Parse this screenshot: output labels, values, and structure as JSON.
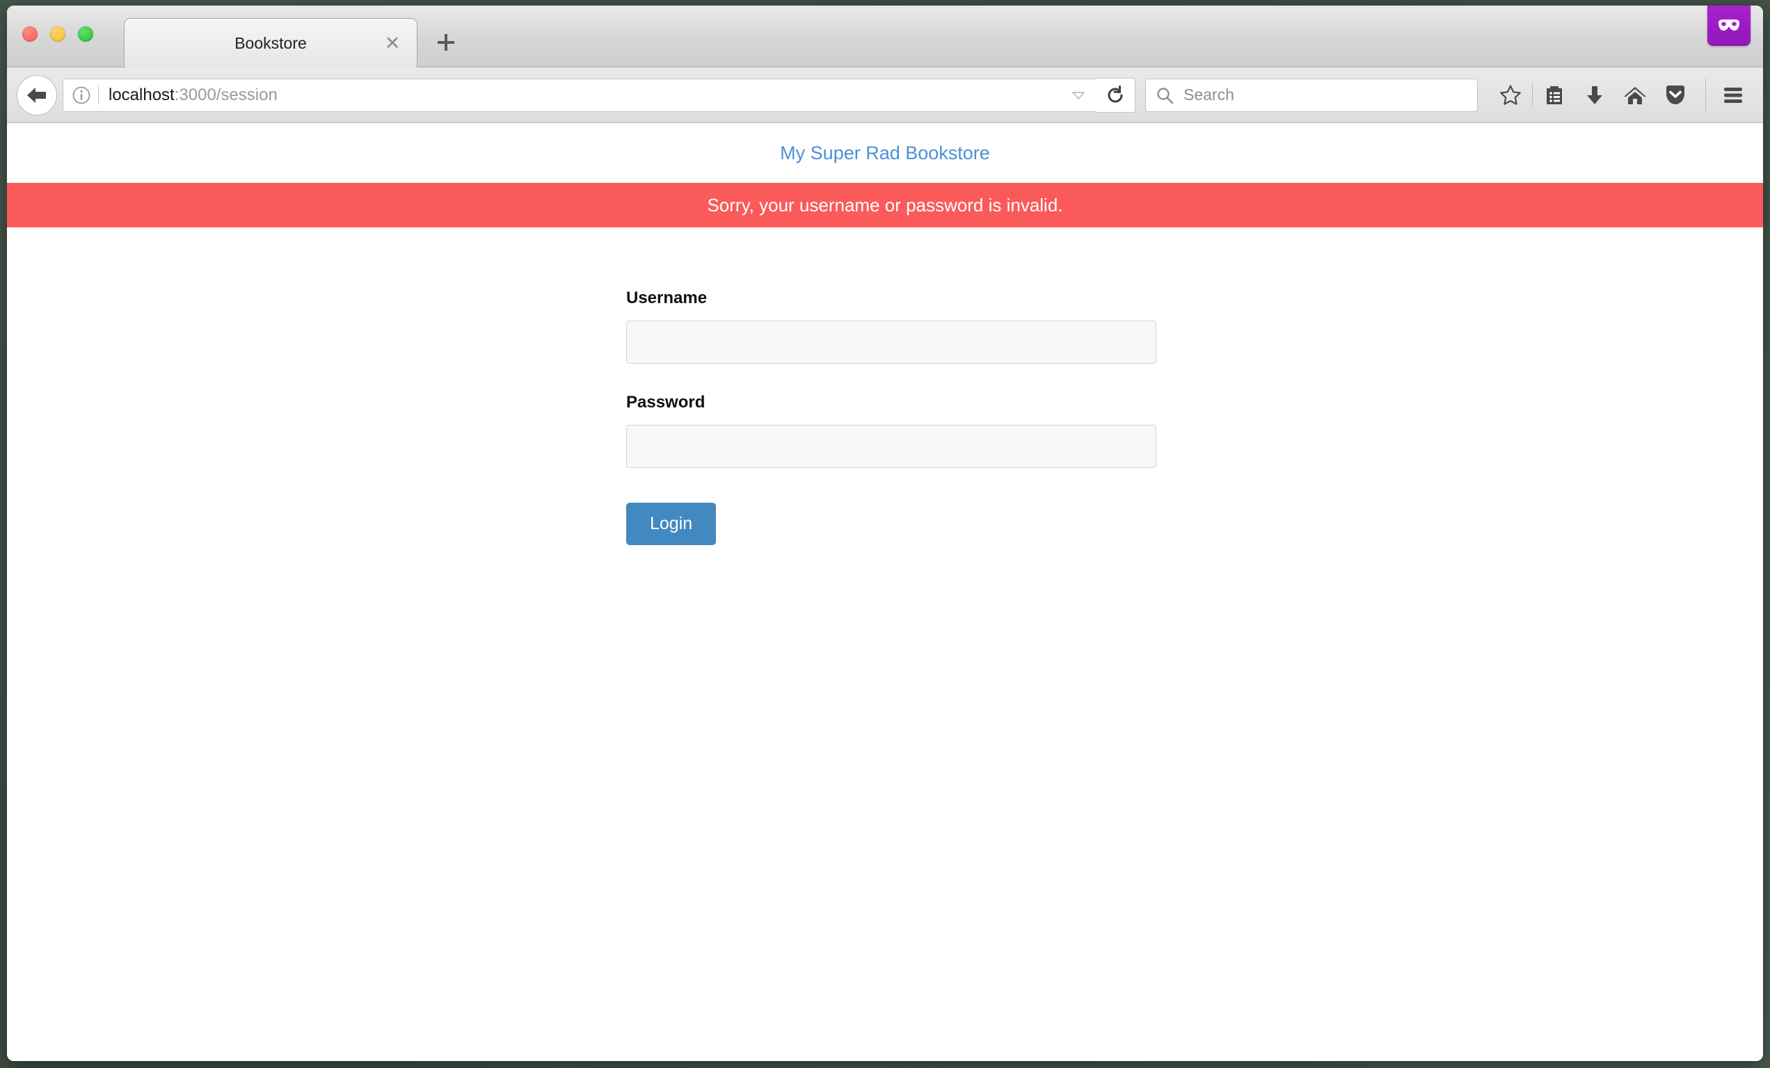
{
  "window": {
    "traffic_lights": [
      "close",
      "minimize",
      "zoom"
    ]
  },
  "tabs": {
    "active": {
      "title": "Bookstore",
      "close_icon": "close-icon"
    },
    "new_tab_label": "+",
    "private_browsing_icon": "mask-icon"
  },
  "toolbar": {
    "back_icon": "back-arrow-icon",
    "identity_icon": "info-icon",
    "url": {
      "host": "localhost",
      "path": ":3000/session",
      "full": "localhost:3000/session"
    },
    "urlbar_dropdown_icon": "chevron-down-icon",
    "reload_icon": "reload-icon",
    "search": {
      "placeholder": "Search",
      "icon": "search-icon"
    },
    "icons": [
      {
        "name": "bookmark-star-icon",
        "label": "Bookmark"
      },
      {
        "name": "library-icon",
        "label": "Library"
      },
      {
        "name": "downloads-icon",
        "label": "Downloads"
      },
      {
        "name": "home-icon",
        "label": "Home"
      },
      {
        "name": "pocket-icon",
        "label": "Pocket"
      },
      {
        "name": "hamburger-menu-icon",
        "label": "Open menu"
      }
    ]
  },
  "page": {
    "site_title": "My Super Rad Bookstore",
    "flash": {
      "message": "Sorry, your username or password is invalid.",
      "background_color": "#fb5a5a",
      "text_color": "#ffffff"
    },
    "form": {
      "username_label": "Username",
      "username_value": "",
      "username_placeholder": "",
      "password_label": "Password",
      "password_value": "",
      "password_placeholder": "",
      "submit_label": "Login",
      "submit_color": "#4289c1"
    },
    "link_color": "#4a90d6"
  }
}
